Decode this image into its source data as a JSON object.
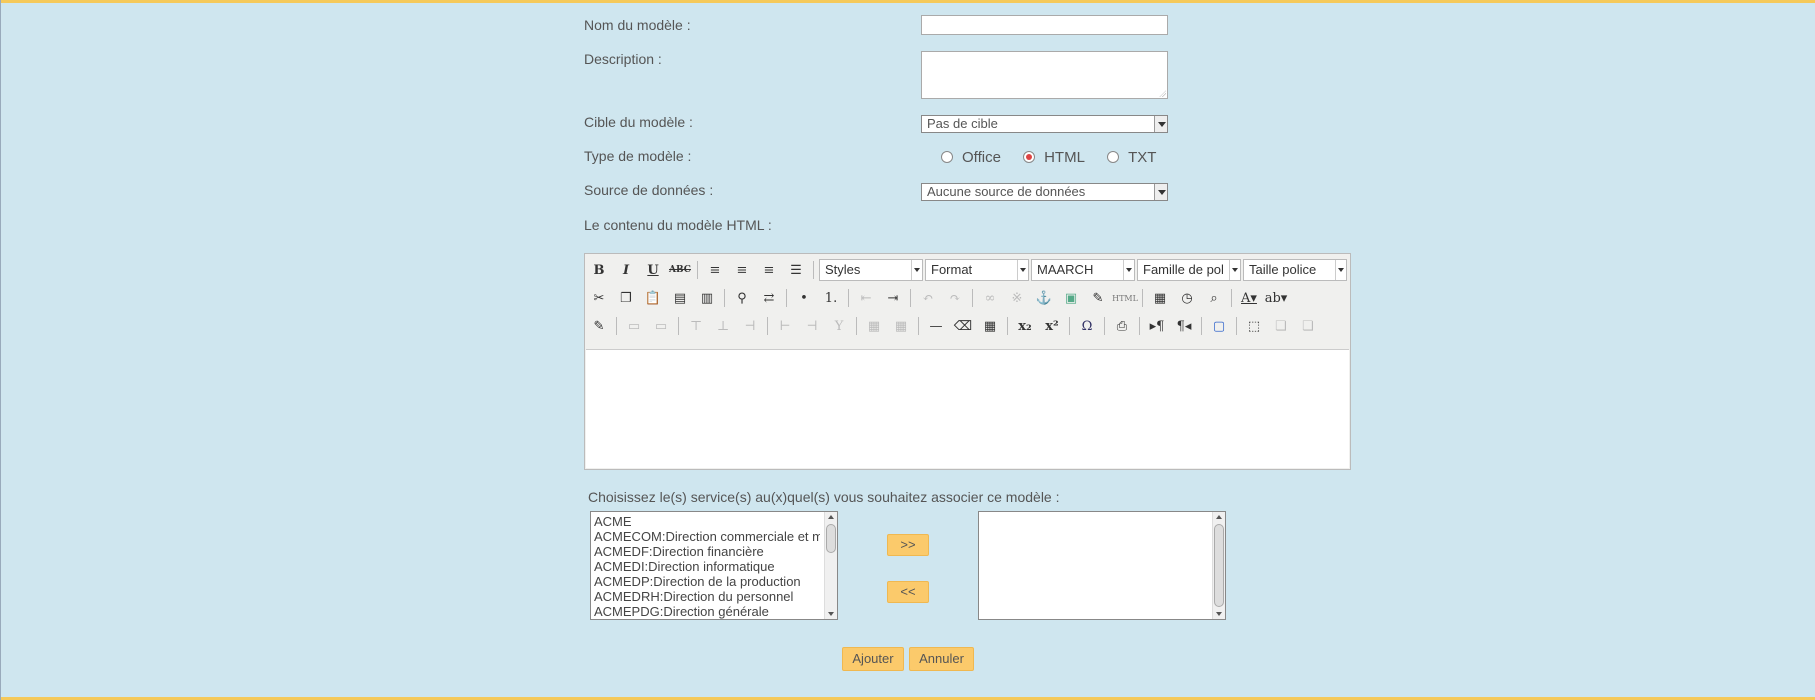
{
  "form": {
    "name_label": "Nom du modèle :",
    "name_value": "",
    "description_label": "Description :",
    "description_value": "",
    "target_label": "Cible du modèle :",
    "target_value": "Pas de cible",
    "type_label": "Type de modèle :",
    "type_options": [
      "Office",
      "HTML",
      "TXT"
    ],
    "type_selected": "HTML",
    "source_label": "Source de données :",
    "source_value": "Aucune source de données",
    "content_label": "Le contenu du modèle HTML :"
  },
  "editor": {
    "selects": [
      "Styles",
      "Format",
      "MAARCH",
      "Famille de pol",
      "Taille police"
    ],
    "buttons_row1": [
      "bold-icon",
      "italic-icon",
      "underline-icon",
      "strikethrough-icon",
      "align-left-icon",
      "align-center-icon",
      "align-right-icon",
      "align-justify-icon"
    ],
    "buttons_row2": [
      "cut-icon",
      "copy-icon",
      "paste-icon",
      "paste-text-icon",
      "paste-word-icon",
      "find-icon",
      "replace-icon",
      "bullet-list-icon",
      "numbered-list-icon",
      "outdent-icon",
      "indent-icon",
      "undo-icon",
      "redo-icon",
      "link-icon",
      "unlink-icon",
      "anchor-icon",
      "image-icon",
      "cleanup-icon",
      "html-icon",
      "insert-date-icon",
      "insert-time-icon",
      "preview-icon",
      "text-color-icon",
      "highlight-color-icon"
    ],
    "buttons_row3": [
      "edit-properties-icon",
      "table-row-icon",
      "table-cell-icon",
      "insert-row-before-icon",
      "insert-row-after-icon",
      "delete-row-icon",
      "insert-col-before-icon",
      "insert-col-after-icon",
      "delete-col-icon",
      "split-cells-icon",
      "merge-cells-icon",
      "horizontal-rule-icon",
      "remove-format-icon",
      "table-icon",
      "subscript-icon",
      "superscript-icon",
      "special-char-icon",
      "print-icon",
      "ltr-icon",
      "rtl-icon",
      "fullscreen-icon",
      "visual-aid-icon",
      "layer-icon",
      "layer-2-icon"
    ],
    "html_button_label": "HTML"
  },
  "services": {
    "prompt": "Choisissez le(s) service(s) au(x)quel(s) vous souhaitez associer ce modèle :",
    "available": [
      "ACME",
      "ACMECOM:Direction commerciale et m",
      "ACMEDF:Direction financière",
      "ACMEDI:Direction informatique",
      "ACMEDP:Direction de la production",
      "ACMEDRH:Direction du personnel",
      "ACMEPDG:Direction générale"
    ],
    "selected": [],
    "add_label": ">>",
    "remove_label": "<<"
  },
  "actions": {
    "submit_label": "Ajouter",
    "cancel_label": "Annuler"
  },
  "colors": {
    "background": "#cfe6ef",
    "accent": "#fbca6b",
    "border_top": "#f5c95a"
  }
}
